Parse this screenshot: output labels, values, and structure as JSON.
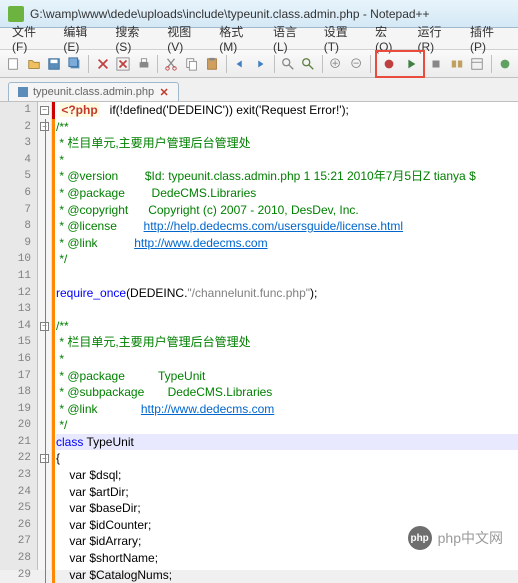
{
  "title": "G:\\wamp\\www\\dede\\uploads\\include\\typeunit.class.admin.php - Notepad++",
  "menubar": {
    "file": "文件(F)",
    "edit": "编辑(E)",
    "search": "搜索(S)",
    "view": "视图(V)",
    "format": "格式(M)",
    "language": "语言(L)",
    "settings": "设置(T)",
    "macro": "宏(O)",
    "run": "运行(R)",
    "plugins": "插件(P)"
  },
  "tab": {
    "filename": "typeunit.class.admin.php"
  },
  "code": {
    "l1_php": "<?php",
    "l1_rest": "   if(!defined('DEDEINC')) exit('Request Error!');",
    "l2": "/**",
    "l3": " * 栏目单元,主要用户管理后台管理处",
    "l4": " *",
    "l5": " * @version        $Id: typeunit.class.admin.php 1 15:21 2010年7月5日Z tianya $",
    "l6": " * @package        DedeCMS.Libraries",
    "l7": " * @copyright      Copyright (c) 2007 - 2010, DesDev, Inc.",
    "l8_label": " * @license        ",
    "l8_link": "http://help.dedecms.com/usersguide/license.html",
    "l9_label": " * @link           ",
    "l9_link": "http://www.dedecms.com",
    "l10": " */",
    "l12_a": "require_once",
    "l12_b": "(DEDEINC.",
    "l12_c": "\"/channelunit.func.php\"",
    "l12_d": ");",
    "l14": "/**",
    "l15": " * 栏目单元,主要用户管理后台管理处",
    "l16": " *",
    "l17": " * @package          TypeUnit",
    "l18": " * @subpackage       DedeCMS.Libraries",
    "l19_label": " * @link             ",
    "l19_link": "http://www.dedecms.com",
    "l20": " */",
    "l21_a": "class",
    "l21_b": " TypeUnit",
    "l22": "{",
    "l23": "    var $dsql;",
    "l24": "    var $artDir;",
    "l25": "    var $baseDir;",
    "l26": "    var $idCounter;",
    "l27": "    var $idArrary;",
    "l28": "    var $shortName;",
    "l29": "    var $CatalogNums;"
  },
  "watermark": {
    "text": "php中文网"
  }
}
